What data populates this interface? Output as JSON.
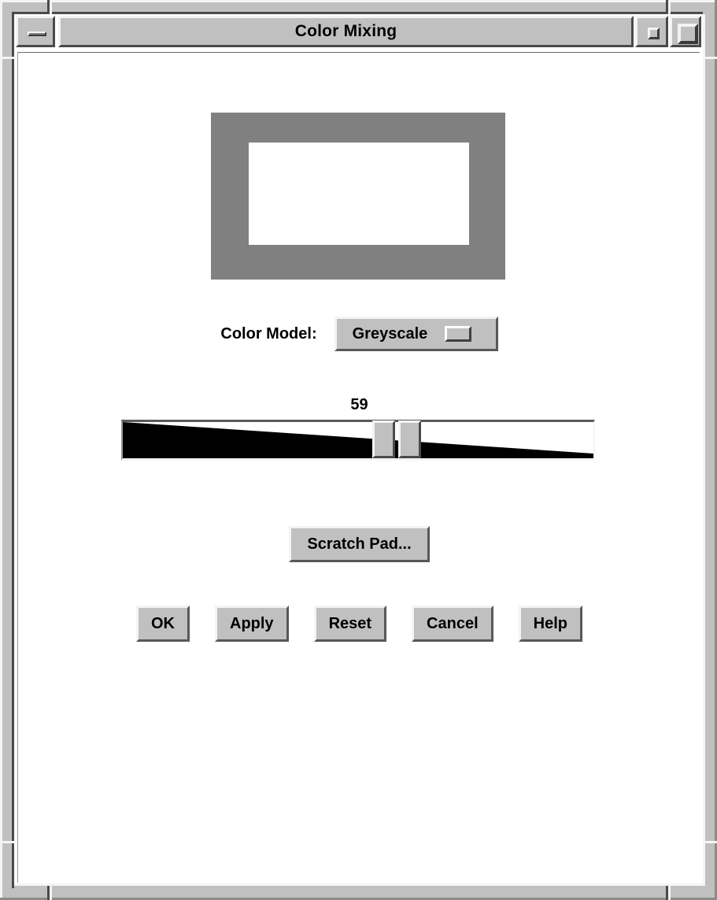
{
  "window": {
    "title": "Color Mixing",
    "controls": {
      "minimize": "minimize",
      "restore": "restore",
      "maximize": "maximize"
    }
  },
  "swatch": {
    "frame_color": "#808080",
    "inner_color": "#ffffff"
  },
  "color_model": {
    "label": "Color Model:",
    "selected": "Greyscale",
    "options": [
      "Greyscale"
    ]
  },
  "scale": {
    "value": "59",
    "value_number": 59,
    "min": 0,
    "max": 100
  },
  "scratch_pad": {
    "label": "Scratch Pad..."
  },
  "actions": [
    {
      "label": "OK",
      "name": "ok-button"
    },
    {
      "label": "Apply",
      "name": "apply-button"
    },
    {
      "label": "Reset",
      "name": "reset-button"
    },
    {
      "label": "Cancel",
      "name": "cancel-button"
    },
    {
      "label": "Help",
      "name": "help-button"
    }
  ],
  "colors": {
    "frame": "#c0c0c0",
    "client_background": "#ffffff",
    "text": "#000000",
    "trough_fill": "#000000",
    "highlight": "#f4f4f4",
    "shadow": "#4a4a4a"
  }
}
